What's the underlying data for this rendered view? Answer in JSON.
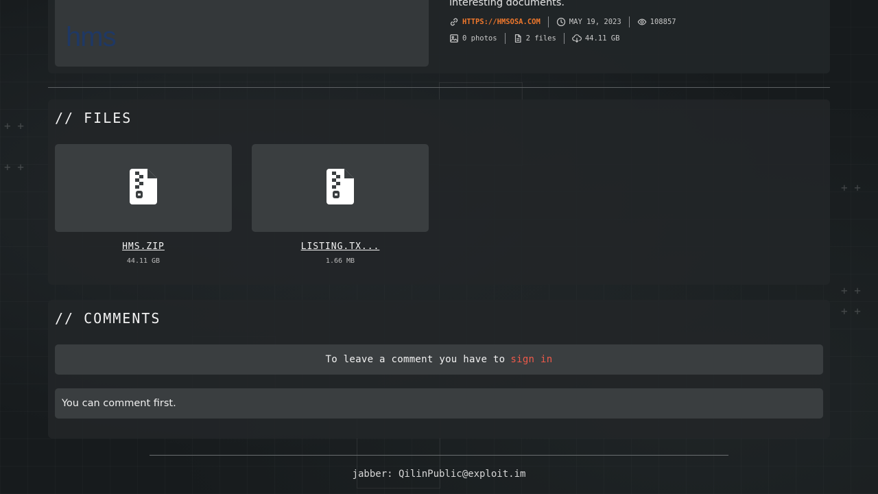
{
  "post": {
    "description_tail": "interesting documents.",
    "website": "HTTPS://HMSOSA.COM",
    "date": "MAY 19, 2023",
    "views": "108857",
    "photos": "0 photos",
    "files_count": "2 files",
    "total_size": "44.11 GB",
    "thumbnail_logo_text": "hms"
  },
  "files_section": {
    "title": "// FILES",
    "files": [
      {
        "name": "HMS.ZIP",
        "size": "44.11 GB",
        "icon": "file-zipper-icon"
      },
      {
        "name": "LISTING.TX...",
        "size": "1.66 MB",
        "icon": "file-zipper-icon"
      }
    ]
  },
  "comments_section": {
    "title": "// COMMENTS",
    "signin_prompt": "To leave a comment you have to",
    "signin_link": "sign in",
    "empty_message": "You can comment first."
  },
  "footer": {
    "contact": "jabber: QilinPublic@exploit.im"
  },
  "colors": {
    "accent_link": "#f0782c",
    "signin_link": "#f05a4a",
    "panel": "#3a3e40",
    "background": "#171b1d"
  }
}
